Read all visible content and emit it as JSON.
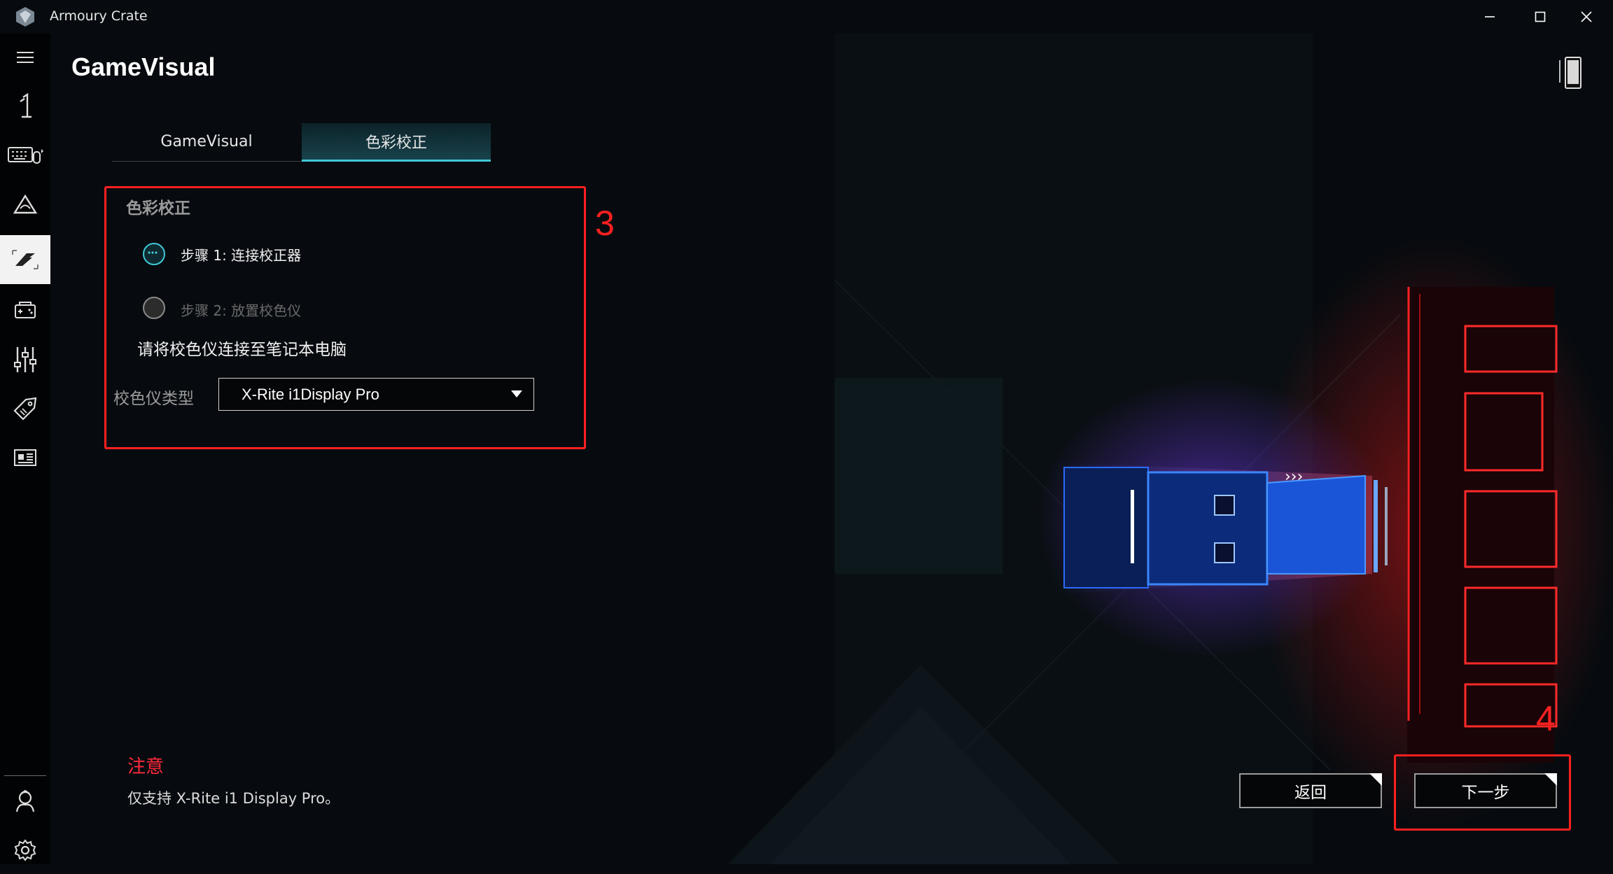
{
  "app": {
    "title": "Armoury Crate"
  },
  "window_controls": {
    "minimize": "minimize-icon",
    "maximize": "maximize-icon",
    "close": "close-icon"
  },
  "sidebar": {
    "items": [
      {
        "icon": "menu-icon"
      },
      {
        "icon": "home-icon"
      },
      {
        "icon": "keyboard-device-icon"
      },
      {
        "icon": "aura-sync-icon"
      },
      {
        "icon": "gamevisual-icon",
        "active": true
      },
      {
        "icon": "game-library-icon"
      },
      {
        "icon": "scenario-profiles-icon"
      },
      {
        "icon": "deals-tag-icon"
      },
      {
        "icon": "news-icon"
      },
      {
        "icon": "user-center-icon"
      },
      {
        "icon": "settings-icon"
      }
    ]
  },
  "page": {
    "title": "GameVisual"
  },
  "tabs": [
    {
      "label": "GameVisual",
      "active": false
    },
    {
      "label": "色彩校正",
      "active": true
    }
  ],
  "calibration": {
    "section_title": "色彩校正",
    "steps": [
      {
        "label": "步骤 1:  连接校正器",
        "state": "active"
      },
      {
        "label": "步骤 2:  放置校色仪",
        "state": "inactive"
      }
    ],
    "instruction": "请将校色仪连接至笔记本电脑",
    "colorimeter_type_label": "校色仪类型",
    "colorimeter_selected": "X-Rite i1Display Pro"
  },
  "note": {
    "title": "注意",
    "text": "仅支持 X-Rite i1 Display Pro。"
  },
  "buttons": {
    "back": "返回",
    "next": "下一步"
  },
  "annotations": {
    "box_3": "3",
    "box_4": "4"
  },
  "colors": {
    "accent": "#3fc8d8",
    "annotation": "#ff2020",
    "note_red": "#ff2a3c"
  }
}
